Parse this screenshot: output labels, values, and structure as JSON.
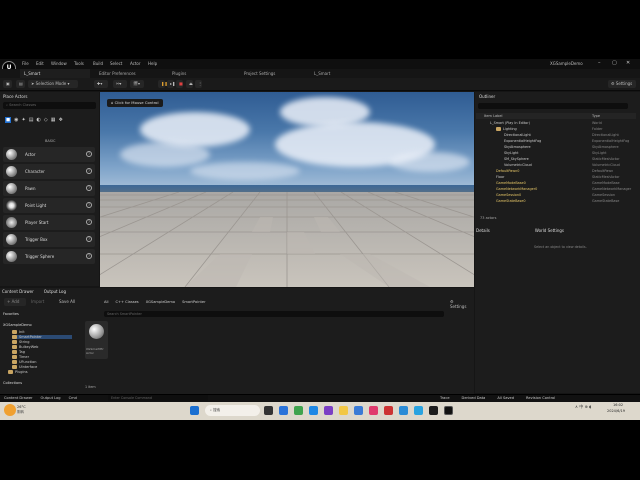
{
  "menubar": {
    "logo": "U",
    "items": [
      "File",
      "Edit",
      "Window",
      "Tools",
      "Build",
      "Select",
      "Actor",
      "Help"
    ],
    "project_name": "XGSampleDemo"
  },
  "tabs": [
    "L_Smart",
    "Editor Preferences",
    "Plugins",
    "Project Settings",
    "L_Smart"
  ],
  "toolbar": {
    "mode_label": "Selection Mode",
    "settings_label": "Settings"
  },
  "place_actors": {
    "title": "Place Actors",
    "search_placeholder": "Search Classes",
    "category": "BASIC",
    "items": [
      "Actor",
      "Character",
      "Pawn",
      "Point Light",
      "Player Start",
      "Trigger Box",
      "Trigger Sphere"
    ]
  },
  "viewport": {
    "mouse_control_label": "Click for Mouse Control"
  },
  "outliner": {
    "title": "Outliner",
    "col_item": "Item Label",
    "col_type": "Type",
    "rows": [
      {
        "label": "L_Smart (Play In Editor)",
        "type": "World"
      },
      {
        "label": "Lighting",
        "type": "Folder"
      },
      {
        "label": "DirectionalLight",
        "type": "DirectionalLight"
      },
      {
        "label": "ExponentialHeightFog",
        "type": "ExponentialHeightFog"
      },
      {
        "label": "SkyAtmosphere",
        "type": "SkyAtmosphere"
      },
      {
        "label": "SkyLight",
        "type": "SkyLight"
      },
      {
        "label": "SM_SkySphere",
        "type": "StaticMeshActor"
      },
      {
        "label": "VolumetricCloud",
        "type": "VolumetricCloud"
      },
      {
        "label": "DefaultPawn0",
        "type": "DefaultPawn"
      },
      {
        "label": "Floor",
        "type": "StaticMeshActor"
      },
      {
        "label": "GameModeBase0",
        "type": "GameModeBase"
      },
      {
        "label": "GameNetworkManager0",
        "type": "GameNetworkManager"
      },
      {
        "label": "GameSession0",
        "type": "GameSession"
      },
      {
        "label": "GameStateBase0",
        "type": "GameStateBase"
      }
    ],
    "count_label": "73 actors"
  },
  "details": {
    "tab_details": "Details",
    "tab_world": "World Settings",
    "empty_text": "Select an object to view details."
  },
  "content_browser": {
    "tab_label": "Content Drawer",
    "tab_output": "Output Log",
    "add_label": "Add",
    "import_label": "Import",
    "save_all_label": "Save All",
    "path": [
      "All",
      "C++ Classes",
      "XGSampleDemo",
      "SmartPointer"
    ],
    "settings_label": "Settings",
    "search_placeholder": "Search SmartPointer",
    "favorites_label": "Favorites",
    "root_label": "XGSampleDemo",
    "tree": [
      "Init",
      "SmartPointer",
      "String",
      "BulkeyWeb",
      "Tag",
      "Timer",
      "UFunction",
      "UInterface",
      "Plugins"
    ],
    "collections_label": "Collections",
    "asset_name": "XGSmartPtr Actor",
    "item_count": "1 item"
  },
  "statusbar": {
    "content_drawer": "Content Drawer",
    "output_log": "Output Log",
    "cmd": "Cmd",
    "cmd_placeholder": "Enter Console Command",
    "trace": "Trace",
    "derived_data": "Derived Data",
    "all_saved": "All Saved",
    "revision": "Revision Control"
  },
  "taskbar": {
    "weather_temp": "26°C",
    "weather_desc": "阴转",
    "search_placeholder": "搜索",
    "time": "16:02",
    "date": "2024/6/19"
  }
}
